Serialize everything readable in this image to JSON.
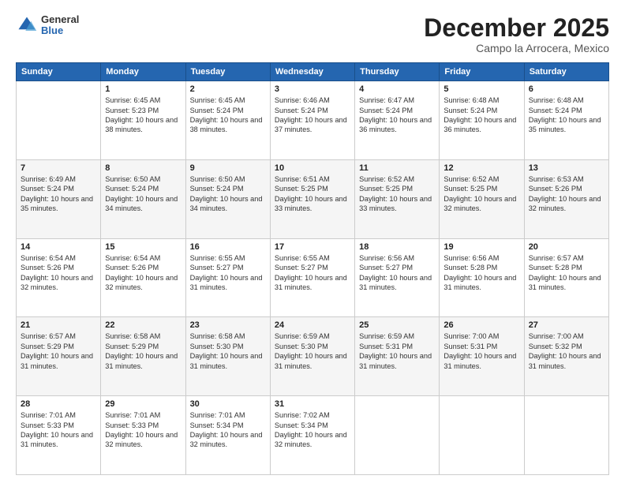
{
  "header": {
    "logo": {
      "general": "General",
      "blue": "Blue"
    },
    "title": "December 2025",
    "location": "Campo la Arrocera, Mexico"
  },
  "weekdays": [
    "Sunday",
    "Monday",
    "Tuesday",
    "Wednesday",
    "Thursday",
    "Friday",
    "Saturday"
  ],
  "weeks": [
    [
      {
        "day": "",
        "sunrise": "",
        "sunset": "",
        "daylight": ""
      },
      {
        "day": "1",
        "sunrise": "Sunrise: 6:45 AM",
        "sunset": "Sunset: 5:23 PM",
        "daylight": "Daylight: 10 hours and 38 minutes."
      },
      {
        "day": "2",
        "sunrise": "Sunrise: 6:45 AM",
        "sunset": "Sunset: 5:24 PM",
        "daylight": "Daylight: 10 hours and 38 minutes."
      },
      {
        "day": "3",
        "sunrise": "Sunrise: 6:46 AM",
        "sunset": "Sunset: 5:24 PM",
        "daylight": "Daylight: 10 hours and 37 minutes."
      },
      {
        "day": "4",
        "sunrise": "Sunrise: 6:47 AM",
        "sunset": "Sunset: 5:24 PM",
        "daylight": "Daylight: 10 hours and 36 minutes."
      },
      {
        "day": "5",
        "sunrise": "Sunrise: 6:48 AM",
        "sunset": "Sunset: 5:24 PM",
        "daylight": "Daylight: 10 hours and 36 minutes."
      },
      {
        "day": "6",
        "sunrise": "Sunrise: 6:48 AM",
        "sunset": "Sunset: 5:24 PM",
        "daylight": "Daylight: 10 hours and 35 minutes."
      }
    ],
    [
      {
        "day": "7",
        "sunrise": "Sunrise: 6:49 AM",
        "sunset": "Sunset: 5:24 PM",
        "daylight": "Daylight: 10 hours and 35 minutes."
      },
      {
        "day": "8",
        "sunrise": "Sunrise: 6:50 AM",
        "sunset": "Sunset: 5:24 PM",
        "daylight": "Daylight: 10 hours and 34 minutes."
      },
      {
        "day": "9",
        "sunrise": "Sunrise: 6:50 AM",
        "sunset": "Sunset: 5:24 PM",
        "daylight": "Daylight: 10 hours and 34 minutes."
      },
      {
        "day": "10",
        "sunrise": "Sunrise: 6:51 AM",
        "sunset": "Sunset: 5:25 PM",
        "daylight": "Daylight: 10 hours and 33 minutes."
      },
      {
        "day": "11",
        "sunrise": "Sunrise: 6:52 AM",
        "sunset": "Sunset: 5:25 PM",
        "daylight": "Daylight: 10 hours and 33 minutes."
      },
      {
        "day": "12",
        "sunrise": "Sunrise: 6:52 AM",
        "sunset": "Sunset: 5:25 PM",
        "daylight": "Daylight: 10 hours and 32 minutes."
      },
      {
        "day": "13",
        "sunrise": "Sunrise: 6:53 AM",
        "sunset": "Sunset: 5:26 PM",
        "daylight": "Daylight: 10 hours and 32 minutes."
      }
    ],
    [
      {
        "day": "14",
        "sunrise": "Sunrise: 6:54 AM",
        "sunset": "Sunset: 5:26 PM",
        "daylight": "Daylight: 10 hours and 32 minutes."
      },
      {
        "day": "15",
        "sunrise": "Sunrise: 6:54 AM",
        "sunset": "Sunset: 5:26 PM",
        "daylight": "Daylight: 10 hours and 32 minutes."
      },
      {
        "day": "16",
        "sunrise": "Sunrise: 6:55 AM",
        "sunset": "Sunset: 5:27 PM",
        "daylight": "Daylight: 10 hours and 31 minutes."
      },
      {
        "day": "17",
        "sunrise": "Sunrise: 6:55 AM",
        "sunset": "Sunset: 5:27 PM",
        "daylight": "Daylight: 10 hours and 31 minutes."
      },
      {
        "day": "18",
        "sunrise": "Sunrise: 6:56 AM",
        "sunset": "Sunset: 5:27 PM",
        "daylight": "Daylight: 10 hours and 31 minutes."
      },
      {
        "day": "19",
        "sunrise": "Sunrise: 6:56 AM",
        "sunset": "Sunset: 5:28 PM",
        "daylight": "Daylight: 10 hours and 31 minutes."
      },
      {
        "day": "20",
        "sunrise": "Sunrise: 6:57 AM",
        "sunset": "Sunset: 5:28 PM",
        "daylight": "Daylight: 10 hours and 31 minutes."
      }
    ],
    [
      {
        "day": "21",
        "sunrise": "Sunrise: 6:57 AM",
        "sunset": "Sunset: 5:29 PM",
        "daylight": "Daylight: 10 hours and 31 minutes."
      },
      {
        "day": "22",
        "sunrise": "Sunrise: 6:58 AM",
        "sunset": "Sunset: 5:29 PM",
        "daylight": "Daylight: 10 hours and 31 minutes."
      },
      {
        "day": "23",
        "sunrise": "Sunrise: 6:58 AM",
        "sunset": "Sunset: 5:30 PM",
        "daylight": "Daylight: 10 hours and 31 minutes."
      },
      {
        "day": "24",
        "sunrise": "Sunrise: 6:59 AM",
        "sunset": "Sunset: 5:30 PM",
        "daylight": "Daylight: 10 hours and 31 minutes."
      },
      {
        "day": "25",
        "sunrise": "Sunrise: 6:59 AM",
        "sunset": "Sunset: 5:31 PM",
        "daylight": "Daylight: 10 hours and 31 minutes."
      },
      {
        "day": "26",
        "sunrise": "Sunrise: 7:00 AM",
        "sunset": "Sunset: 5:31 PM",
        "daylight": "Daylight: 10 hours and 31 minutes."
      },
      {
        "day": "27",
        "sunrise": "Sunrise: 7:00 AM",
        "sunset": "Sunset: 5:32 PM",
        "daylight": "Daylight: 10 hours and 31 minutes."
      }
    ],
    [
      {
        "day": "28",
        "sunrise": "Sunrise: 7:01 AM",
        "sunset": "Sunset: 5:33 PM",
        "daylight": "Daylight: 10 hours and 31 minutes."
      },
      {
        "day": "29",
        "sunrise": "Sunrise: 7:01 AM",
        "sunset": "Sunset: 5:33 PM",
        "daylight": "Daylight: 10 hours and 32 minutes."
      },
      {
        "day": "30",
        "sunrise": "Sunrise: 7:01 AM",
        "sunset": "Sunset: 5:34 PM",
        "daylight": "Daylight: 10 hours and 32 minutes."
      },
      {
        "day": "31",
        "sunrise": "Sunrise: 7:02 AM",
        "sunset": "Sunset: 5:34 PM",
        "daylight": "Daylight: 10 hours and 32 minutes."
      },
      {
        "day": "",
        "sunrise": "",
        "sunset": "",
        "daylight": ""
      },
      {
        "day": "",
        "sunrise": "",
        "sunset": "",
        "daylight": ""
      },
      {
        "day": "",
        "sunrise": "",
        "sunset": "",
        "daylight": ""
      }
    ]
  ]
}
